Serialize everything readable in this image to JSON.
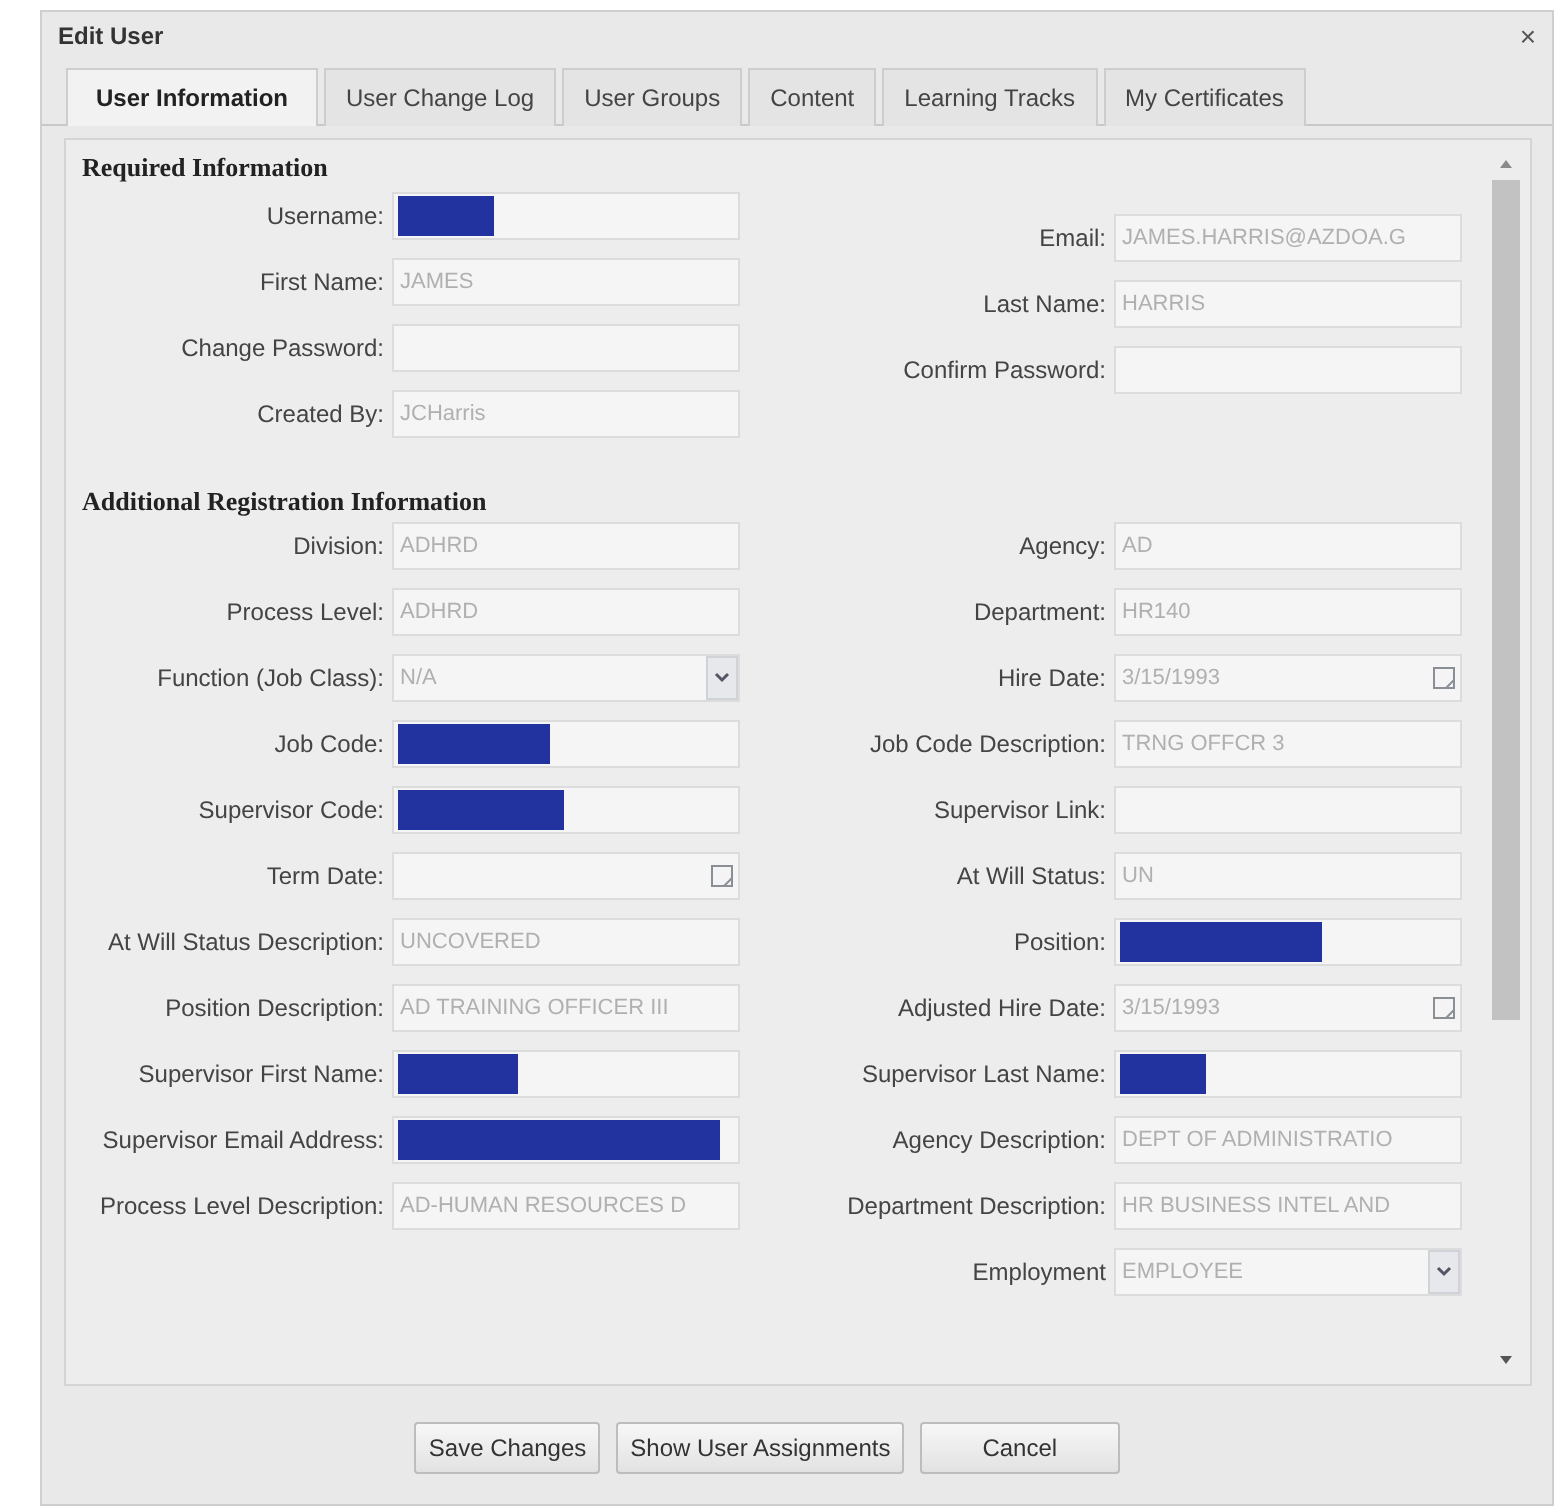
{
  "window": {
    "title": "Edit User",
    "close": "×"
  },
  "tabs": [
    {
      "label": "User Information",
      "selected": true
    },
    {
      "label": "User Change Log",
      "selected": false
    },
    {
      "label": "User Groups",
      "selected": false
    },
    {
      "label": "Content",
      "selected": false
    },
    {
      "label": "Learning Tracks",
      "selected": false
    },
    {
      "label": "My Certificates",
      "selected": false
    }
  ],
  "required": {
    "title": "Required Information",
    "left": [
      {
        "label": "Username:",
        "kind": "redacted",
        "level": 0.29
      },
      {
        "label": "First Name:",
        "kind": "text",
        "value": "JAMES"
      },
      {
        "label": "Change Password:",
        "kind": "text"
      },
      {
        "label": "Created By:",
        "kind": "text",
        "value": "JCHarris"
      }
    ],
    "right": [
      {
        "label": "Email:",
        "kind": "text",
        "value": "JAMES.HARRIS@AZDOA.G"
      },
      {
        "label": "Last Name:",
        "kind": "text",
        "value": "HARRIS"
      },
      {
        "label": "Confirm Password:",
        "kind": "text"
      }
    ]
  },
  "additional": {
    "title": "Additional Registration Information",
    "left": [
      {
        "label": "Division:",
        "kind": "text",
        "value": "ADHRD"
      },
      {
        "label": "Process Level:",
        "kind": "text",
        "value": "ADHRD"
      },
      {
        "label": "Function (Job Class):",
        "kind": "combo",
        "value": "N/A"
      },
      {
        "label": "Job Code:",
        "kind": "redacted",
        "level": 0.46
      },
      {
        "label": "Supervisor Code:",
        "kind": "redacted",
        "level": 0.5
      },
      {
        "label": "Term Date:",
        "kind": "date"
      },
      {
        "label": "At Will Status Description:",
        "kind": "text",
        "value": "UNCOVERED"
      },
      {
        "label": "Position Description:",
        "kind": "text",
        "value": "AD TRAINING OFFICER III"
      },
      {
        "label": "Supervisor First Name:",
        "kind": "redacted",
        "level": 0.36
      },
      {
        "label": "Supervisor Email Address:",
        "kind": "redacted",
        "level": 0.97
      },
      {
        "label": "Process Level Description:",
        "kind": "text",
        "value": "AD-HUMAN RESOURCES D"
      }
    ],
    "right": [
      {
        "label": "Agency:",
        "kind": "text",
        "value": "AD"
      },
      {
        "label": "Department:",
        "kind": "text",
        "value": "HR140"
      },
      {
        "label": "Hire Date:",
        "kind": "date",
        "value": "3/15/1993"
      },
      {
        "label": "Job Code Description:",
        "kind": "text",
        "value": "TRNG OFFCR 3"
      },
      {
        "label": "Supervisor Link:",
        "kind": "text"
      },
      {
        "label": "At Will Status:",
        "kind": "text",
        "value": "UN"
      },
      {
        "label": "Position:",
        "kind": "redacted",
        "level": 0.61
      },
      {
        "label": "Adjusted Hire Date:",
        "kind": "date",
        "value": "3/15/1993"
      },
      {
        "label": "Supervisor Last Name:",
        "kind": "redacted",
        "level": 0.26
      },
      {
        "label": "Agency Description:",
        "kind": "text",
        "value": "DEPT OF ADMINISTRATIO"
      },
      {
        "label": "Department Description:",
        "kind": "text",
        "value": "HR BUSINESS INTEL AND"
      },
      {
        "label": "Employment",
        "kind": "combo",
        "value": "EMPLOYEE"
      }
    ]
  },
  "buttons": [
    "Save Changes",
    "Show User Assignments",
    "Cancel"
  ]
}
